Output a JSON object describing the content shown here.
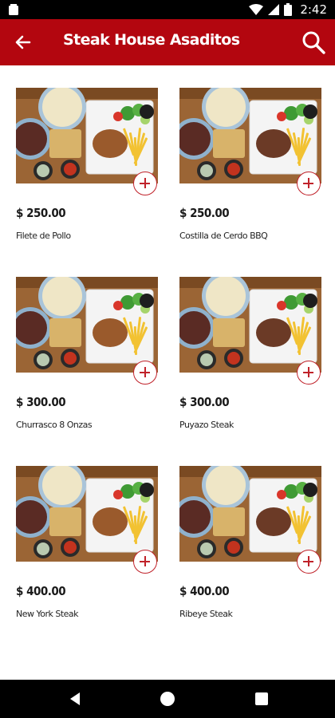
{
  "status_bar": {
    "time": "2:42",
    "icons": [
      "notification-icon",
      "wifi-icon",
      "signal-icon",
      "battery-icon"
    ]
  },
  "app_bar": {
    "title": "Steak House Asaditos",
    "back_icon": "arrow-left-icon",
    "search_icon": "search-icon"
  },
  "colors": {
    "app_bar": "#b3060f",
    "add_button": "#c0222a"
  },
  "products": [
    {
      "price": "$ 250.00",
      "name": "Filete de Pollo"
    },
    {
      "price": "$ 250.00",
      "name": "Costilla de Cerdo BBQ"
    },
    {
      "price": "$ 300.00",
      "name": "Churrasco 8 Onzas"
    },
    {
      "price": "$ 300.00",
      "name": "Puyazo Steak"
    },
    {
      "price": "$ 400.00",
      "name": "New York Steak"
    },
    {
      "price": "$ 400.00",
      "name": "Ribeye Steak"
    }
  ],
  "nav_bar": {
    "icons": [
      "nav-back-icon",
      "nav-home-icon",
      "nav-recent-apps-icon"
    ]
  }
}
